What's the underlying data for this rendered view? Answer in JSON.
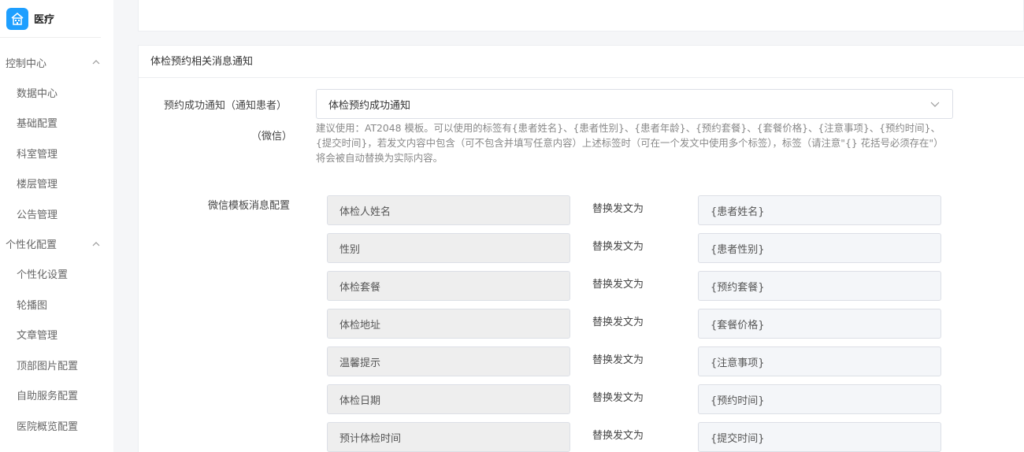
{
  "brand": {
    "name": "医疗",
    "logo_icon": "hospital-icon",
    "logo_color": "#1e9fff"
  },
  "sidebar": {
    "groups": [
      {
        "label": "控制中心",
        "items": [
          "数据中心",
          "基础配置",
          "科室管理",
          "楼层管理",
          "公告管理"
        ]
      },
      {
        "label": "个性化配置",
        "items": [
          "个性化设置",
          "轮播图",
          "文章管理",
          "顶部图片配置",
          "自助服务配置",
          "医院概览配置"
        ]
      }
    ]
  },
  "section": {
    "title": "体检预约相关消息通知",
    "notify_label_line1": "预约成功通知（通知患者）",
    "notify_label_line2": "（微信）",
    "selected_template": "体检预约成功通知",
    "help_text": "建议使用：AT2048 模板。可以使用的标签有{患者姓名}、{患者性别}、{患者年龄}、{预约套餐}、{套餐价格}、{注意事项}、{预约时间}、{提交时间}，若发文内容中包含（可不包含并填写任意内容）上述标签时（可在一个发文中使用多个标签），标签（请注意\"{} 花括号必须存在\"）将会被自动替换为实际内容。",
    "wechat_config_label": "微信模板消息配置",
    "replace_label": "替换发文为",
    "mappings": [
      {
        "field": "体检人姓名",
        "value": "{患者姓名}"
      },
      {
        "field": "性别",
        "value": "{患者性别}"
      },
      {
        "field": "体检套餐",
        "value": "{预约套餐}"
      },
      {
        "field": "体检地址",
        "value": "{套餐价格}"
      },
      {
        "field": "温馨提示",
        "value": "{注意事项}"
      },
      {
        "field": "体检日期",
        "value": "{预约时间}"
      },
      {
        "field": "预计体检时间",
        "value": "{提交时间}"
      }
    ]
  }
}
